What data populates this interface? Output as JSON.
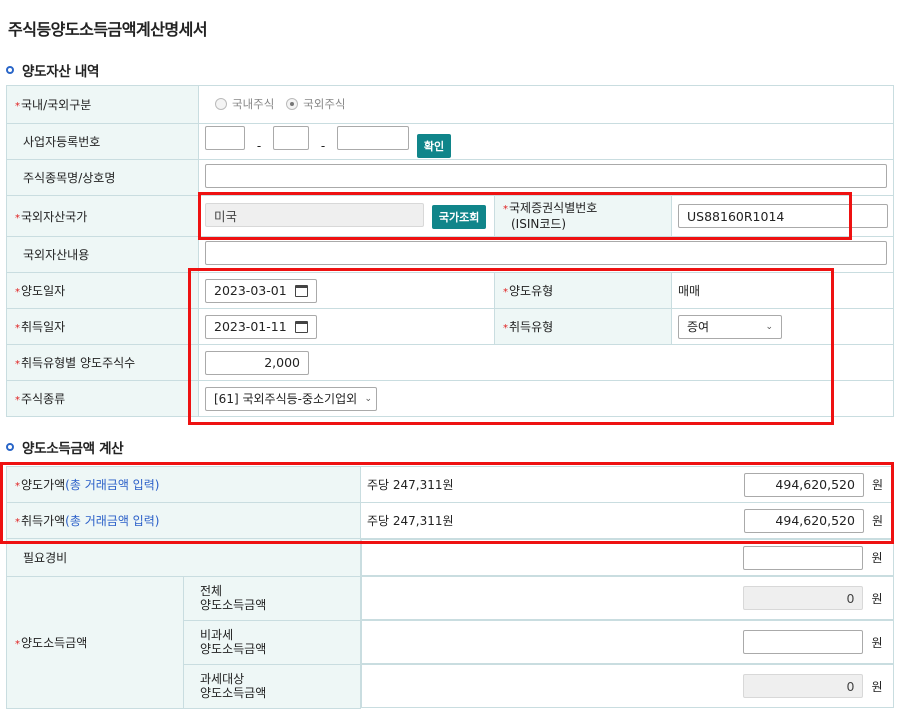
{
  "title": "주식등양도소득금액계산명세서",
  "section1": {
    "title": "양도자산 내역",
    "domestic_foreign_label": "국내/국외구분",
    "radio_domestic": "국내주식",
    "radio_foreign": "국외주식",
    "business_no_label": "사업자등록번호",
    "dash": "-",
    "confirm_button": "확인",
    "stock_name_label": "주식종목명/상호명",
    "foreign_country_label": "국외자산국가",
    "foreign_country_value": "미국",
    "country_lookup_button": "국가조회",
    "isin_label_line1": "국제증권식별번호",
    "isin_label_line2": "(ISIN코드)",
    "isin_value": "US88160R1014",
    "foreign_asset_label": "국외자산내용",
    "transfer_date_label": "양도일자",
    "transfer_date_value": "2023-03-01",
    "transfer_type_label": "양도유형",
    "transfer_type_value": "매매",
    "acquire_date_label": "취득일자",
    "acquire_date_value": "2023-01-11",
    "acquire_type_label": "취득유형",
    "acquire_type_value": "증여",
    "shares_label": "취득유형별 양도주식수",
    "shares_value": "2,000",
    "stock_type_label": "주식종류",
    "stock_type_value": "[61] 국외주식등-중소기업외"
  },
  "section2": {
    "title": "양도소득금액 계산",
    "transfer_price_label": "양도가액",
    "transfer_price_link": "(총 거래금액 입력)",
    "transfer_per_share": "주당 247,311원",
    "transfer_price_value": "494,620,520",
    "acquire_price_label": "취득가액",
    "acquire_price_link": "(총 거래금액 입력)",
    "acquire_per_share": "주당 247,311원",
    "acquire_price_value": "494,620,520",
    "expense_label": "필요경비",
    "expense_value": "",
    "income_label": "양도소득금액",
    "total_label_1": "전체",
    "total_label_2": "양도소득금액",
    "total_value": "0",
    "nontax_label_1": "비과세",
    "nontax_label_2": "양도소득금액",
    "nontax_value": "",
    "taxable_label_1": "과세대상",
    "taxable_label_2": "양도소득금액",
    "taxable_value": "0",
    "unit": "원"
  },
  "colors": {
    "accent": "#10858a",
    "header_bg": "#eef7f6",
    "border": "#c9dde0",
    "highlight": "#ee1111",
    "link": "#2a5fc8"
  }
}
